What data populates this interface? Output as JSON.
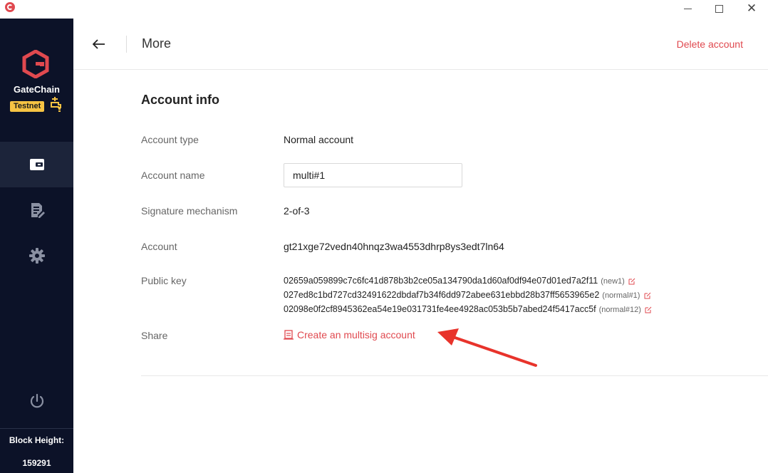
{
  "window": {
    "minimize_icon": "minimize-icon",
    "maximize_icon": "maximize-icon",
    "close_icon": "close-icon"
  },
  "sidebar": {
    "brand": "GateChain",
    "network_badge": "Testnet",
    "block_height_label": "Block Height:",
    "block_height_value": "159291"
  },
  "header": {
    "title": "More",
    "delete_label": "Delete account"
  },
  "account_info": {
    "title": "Account info",
    "type_label": "Account type",
    "type_value": "Normal account",
    "name_label": "Account name",
    "name_value": "multi#1",
    "signature_label": "Signature mechanism",
    "signature_value": "2-of-3",
    "account_label": "Account",
    "account_value": "gt21xge72vedn40hnqz3wa4553dhrp8ys3edt7ln64",
    "pubkey_label": "Public key",
    "public_keys": [
      {
        "key": "02659a059899c7c6fc41d878b3b2ce05a134790da1d60af0df94e07d01ed7a2f11",
        "tag": "(new1)"
      },
      {
        "key": "027ed8c1bd727cd32491622dbdaf7b34f6dd972abee631ebbd28b37ff5653965e2",
        "tag": "(normal#1)"
      },
      {
        "key": "02098e0f2cf8945362ea54e19e031731fe4ee4928ac053b5b7abed24f5417acc5f",
        "tag": "(normal#12)"
      }
    ],
    "share_label": "Share",
    "share_link": "Create an multisig account"
  },
  "colors": {
    "accent": "#e0494f",
    "sidebar": "#0c1228",
    "badge": "#f6c343"
  }
}
